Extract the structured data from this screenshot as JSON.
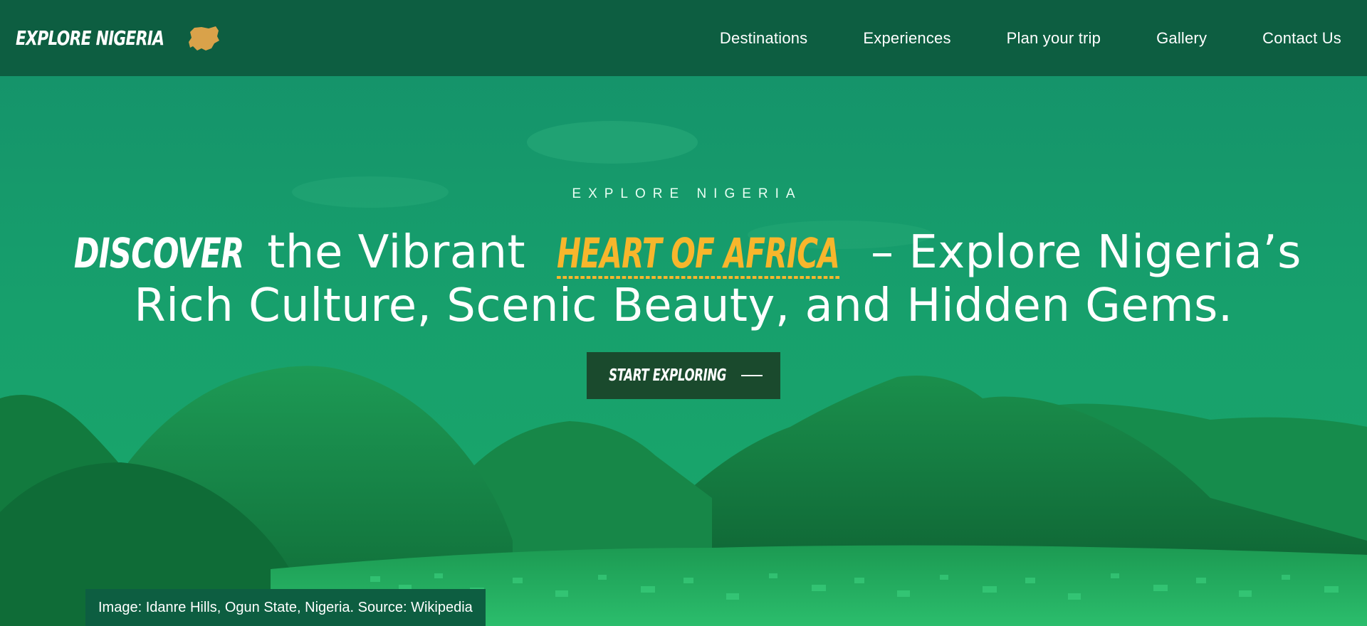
{
  "nav": {
    "brand": "Explore Nigeria",
    "brand_icon": "nigeria-map-icon",
    "links": [
      {
        "label": "Destinations"
      },
      {
        "label": "Experiences"
      },
      {
        "label": "Plan your trip"
      },
      {
        "label": "Gallery"
      },
      {
        "label": "Contact Us"
      }
    ]
  },
  "hero": {
    "eyebrow": "EXPLORE NIGERIA",
    "headline": {
      "accent_word": "Discover",
      "part1": " the Vibrant ",
      "highlight": "Heart of Africa",
      "part2": " – Explore Nigeria’s",
      "line2": "Rich Culture, Scenic Beauty, and Hidden Gems."
    },
    "cta_label": "Start Exploring",
    "cta_icon": "arrow-right-icon",
    "caption": "Image: Idanre Hills, Ogun State, Nigeria. Source: Wikipedia"
  },
  "colors": {
    "nav_bg": "#0d5e41",
    "hero_tint": "#13945f",
    "accent": "#f7b62c",
    "cta_bg": "#1a4a2d",
    "text": "#ffffff"
  }
}
